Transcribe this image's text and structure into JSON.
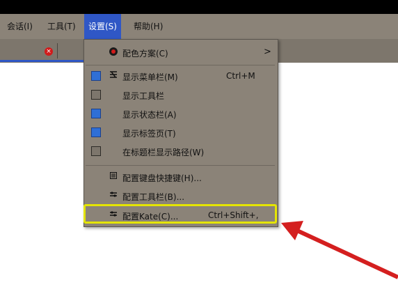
{
  "menubar": {
    "items": [
      {
        "label": "会话(I)"
      },
      {
        "label": "工具(T)"
      },
      {
        "label": "设置(S)"
      },
      {
        "label": "帮助(H)"
      }
    ]
  },
  "tab": {
    "close_symbol": "×"
  },
  "settings_menu": {
    "color_scheme": {
      "label": "配色方案(C)",
      "submenu_arrow": ">"
    },
    "show_menubar": {
      "label": "显示菜单栏(M)",
      "shortcut": "Ctrl+M",
      "checked": true
    },
    "show_toolbar": {
      "label": "显示工具栏",
      "checked": false
    },
    "show_statusbar": {
      "label": "显示状态栏(A)",
      "checked": true
    },
    "show_tabs": {
      "label": "显示标签页(T)",
      "checked": true
    },
    "show_path": {
      "label": "在标题栏显示路径(W)",
      "checked": false
    },
    "configure_shortcuts": {
      "label": "配置键盘快捷键(H)..."
    },
    "configure_toolbars": {
      "label": "配置工具栏(B)..."
    },
    "configure_kate": {
      "label": "配置Kate(C)...",
      "shortcut": "Ctrl+Shift+,"
    }
  },
  "colors": {
    "menu_bg": "#8b8378",
    "accent_blue": "#2f57c6",
    "highlight_yellow": "#e4e400",
    "arrow_red": "#d41f1f"
  }
}
